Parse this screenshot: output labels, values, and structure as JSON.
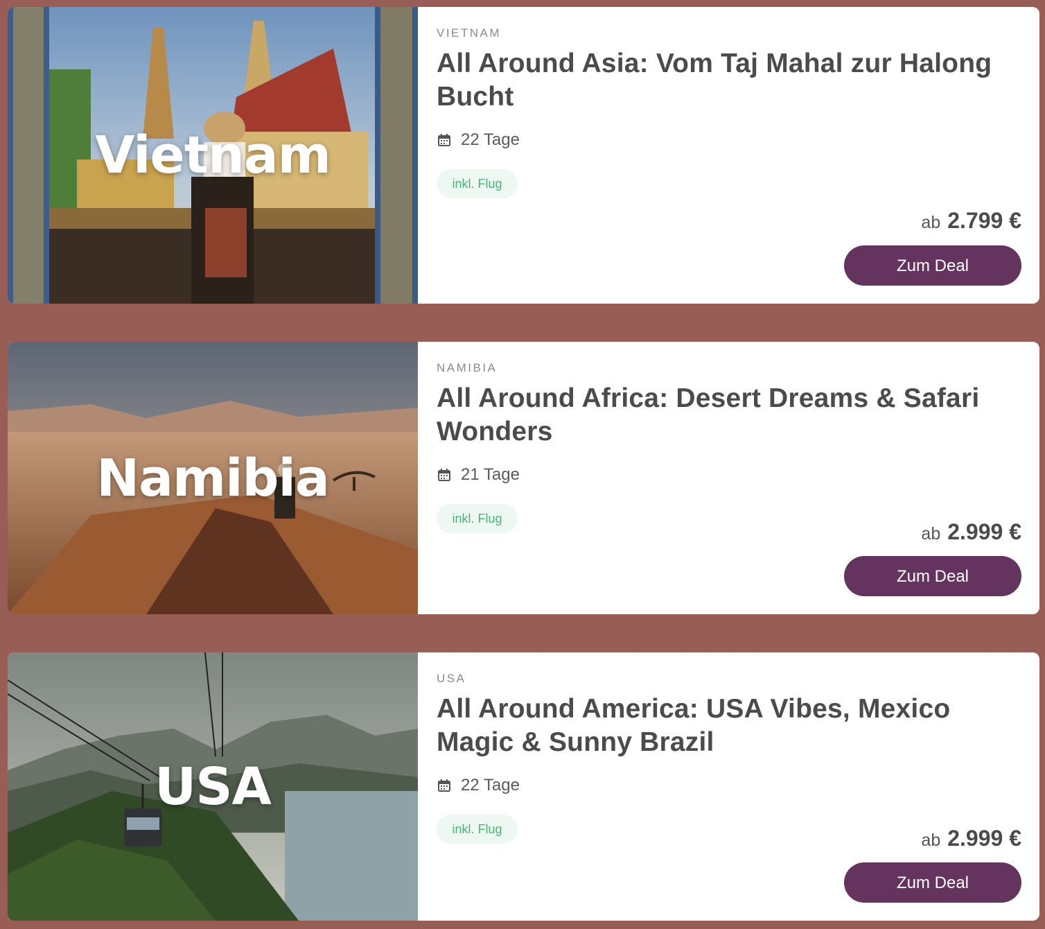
{
  "deals": [
    {
      "image_label": "Vietnam",
      "country": "VIETNAM",
      "title": "All Around Asia: Vom Taj Mahal zur Halong Bucht",
      "duration": "22 Tage",
      "badge": "inkl. Flug",
      "price_prefix": "ab",
      "price": "2.799 €",
      "button_label": "Zum Deal"
    },
    {
      "image_label": "Namibia",
      "country": "NAMIBIA",
      "title": "All Around Africa: Desert Dreams & Safari Wonders",
      "duration": "21 Tage",
      "badge": "inkl. Flug",
      "price_prefix": "ab",
      "price": "2.999 €",
      "button_label": "Zum Deal"
    },
    {
      "image_label": "USA",
      "country": "USA",
      "title": "All Around America: USA Vibes, Mexico Magic & Sunny Brazil",
      "duration": "22 Tage",
      "badge": "inkl. Flug",
      "price_prefix": "ab",
      "price": "2.999 €",
      "button_label": "Zum Deal"
    }
  ],
  "colors": {
    "background": "#985e55",
    "button": "#64335e",
    "badge_bg": "#eef8f2",
    "badge_text": "#4fb078",
    "title_text": "#4b4b4b"
  },
  "icons": {
    "duration": "calendar-icon"
  }
}
